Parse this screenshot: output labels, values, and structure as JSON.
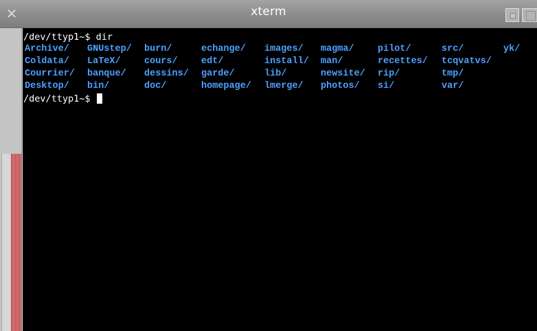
{
  "window": {
    "title": "xterm",
    "close_glyph": "✕",
    "close_icon": "close-icon",
    "minimize_icon": "minimize-icon",
    "maximize_icon": "maximize-icon",
    "colors": {
      "terminal_bg": "#000000",
      "prompt_text": "#ffffff",
      "directory_text": "#4ea0ff",
      "titlebar": "#8c8c8c",
      "scroll_thumb": "#b62f2f"
    }
  },
  "terminal": {
    "command_line": "/dev/ttyp1~$ dir",
    "prompt": "/dev/ttyp1~$ ",
    "listing": [
      [
        "Archive/",
        "GNUstep/",
        "burn/",
        "echange/",
        "images/",
        "magma/",
        "pilot/",
        "src/",
        "yk/"
      ],
      [
        "Coldata/",
        "LaTeX/",
        "cours/",
        "edt/",
        "install/",
        "man/",
        "recettes/",
        "tcqvatvs/"
      ],
      [
        "Courrier/",
        "banque/",
        "dessins/",
        "garde/",
        "lib/",
        "newsite/",
        "rip/",
        "tmp/"
      ],
      [
        "Desktop/",
        "bin/",
        "doc/",
        "homepage/",
        "lmerge/",
        "photos/",
        "si/",
        "var/"
      ]
    ]
  }
}
